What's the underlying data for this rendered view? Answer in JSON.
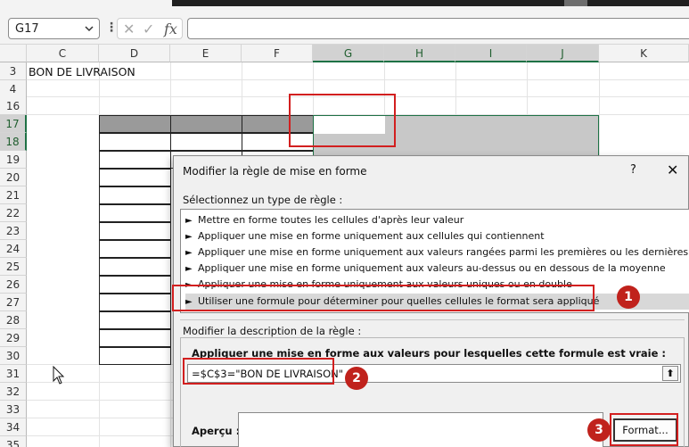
{
  "formula_bar": {
    "name_box": "G17",
    "fx": "fx",
    "cancel": "✕",
    "enter": "✓"
  },
  "columns": [
    "C",
    "D",
    "E",
    "F",
    "G",
    "H",
    "I",
    "J",
    "K"
  ],
  "rows": [
    "3",
    "4",
    "16",
    "17",
    "18",
    "19",
    "20",
    "21",
    "22",
    "23",
    "24",
    "25",
    "26",
    "27",
    "28",
    "29",
    "30",
    "31",
    "32",
    "33",
    "34",
    "35"
  ],
  "cells": {
    "c3": "BON DE LIVRAISON"
  },
  "dialog": {
    "title": "Modifier la règle de mise en forme",
    "help": "?",
    "close": "✕",
    "rule_type_label": "Sélectionnez un type de règle :",
    "rule_types": [
      "Mettre en forme toutes les cellules d'après leur valeur",
      "Appliquer une mise en forme uniquement aux cellules qui contiennent",
      "Appliquer une mise en forme uniquement aux valeurs rangées parmi les premières ou les dernières valeurs",
      "Appliquer une mise en forme uniquement aux valeurs au-dessus ou en dessous de la moyenne",
      "Appliquer une mise en forme uniquement aux valeurs uniques ou en double",
      "Utiliser une formule pour déterminer pour quelles cellules le format sera appliqué"
    ],
    "selected_rule_index": 5,
    "description_label": "Modifier la description de la règle :",
    "formula_label": "Appliquer une mise en forme aux valeurs pour lesquelles cette formule est vraie :",
    "formula_value": "=$C$3=\"BON DE LIVRAISON\"",
    "preview_label": "Aperçu :",
    "format_button": "Format..."
  },
  "badges": [
    "1",
    "2",
    "3"
  ],
  "colors": {
    "annotation_red": "#d21f1f",
    "badge_red": "#c0221c",
    "excel_green": "#1e7145"
  }
}
